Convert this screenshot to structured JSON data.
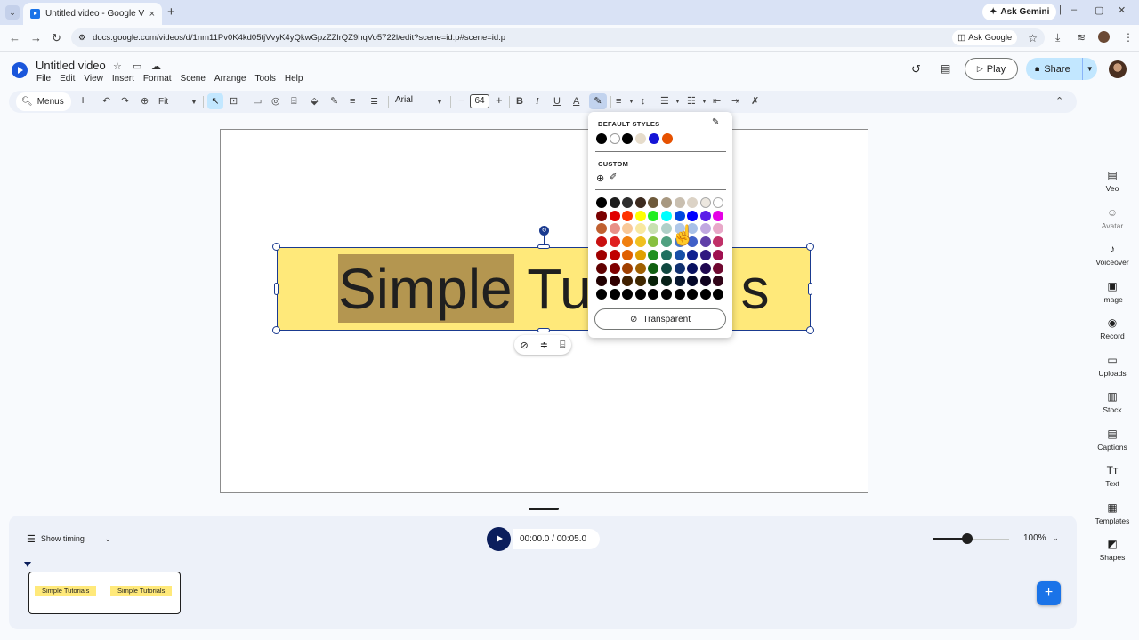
{
  "browser": {
    "tab_title": "Untitled video - Google Vids",
    "tab_close": "×",
    "new_tab": "+",
    "url": "docs.google.com/videos/d/1nm11Pv0K4kd05tjVvyK4yQkwGpzZZlrQZ9hqVo5722l/edit?scene=id.p#scene=id.p",
    "ask_google": "Ask Google",
    "ask_gemini": "Ask Gemini"
  },
  "app": {
    "title": "Untitled video",
    "menus": [
      "File",
      "Edit",
      "View",
      "Insert",
      "Format",
      "Scene",
      "Arrange",
      "Tools",
      "Help"
    ],
    "play_label": "Play",
    "share_label": "Share"
  },
  "toolbar": {
    "menus_label": "Menus",
    "zoom": "Fit",
    "font": "Arial",
    "font_size": "64"
  },
  "canvas": {
    "text": "Simple Tutorials",
    "text_left": "Simple Tu",
    "text_right": "s"
  },
  "palette": {
    "default_label": "DEFAULT STYLES",
    "custom_label": "CUSTOM",
    "transparent_label": "Transparent",
    "default_colors": [
      "#000000",
      "#ffffff",
      "#000000",
      "#e6dccb",
      "#1414d6",
      "#e65100"
    ],
    "grid": [
      [
        "#000000",
        "#1c1c1c",
        "#2e2e2e",
        "#3d2b1f",
        "#6e5a3b",
        "#a89880",
        "#c9bfb0",
        "#dcd3c6",
        "#ece7df",
        "#ffffff"
      ],
      [
        "#7a0000",
        "#e00000",
        "#ff3300",
        "#ffff00",
        "#22ee22",
        "#00ffff",
        "#0047e0",
        "#0000ff",
        "#5a1ee8",
        "#e600e6"
      ],
      [
        "#c06030",
        "#e89088",
        "#f8c898",
        "#f8e8a0",
        "#c8e0b0",
        "#b0d0c8",
        "#b0c8e8",
        "#a8c0e8",
        "#c0a8e0",
        "#e8a8c8"
      ],
      [
        "#c81010",
        "#e02020",
        "#f08010",
        "#f0c020",
        "#88c040",
        "#50a080",
        "#4878c8",
        "#4060c8",
        "#6040a8",
        "#c03068"
      ],
      [
        "#a00000",
        "#c00000",
        "#e06000",
        "#e0a000",
        "#209020",
        "#207060",
        "#1850a8",
        "#102090",
        "#301880",
        "#a01050"
      ],
      [
        "#600000",
        "#800000",
        "#a04000",
        "#a06000",
        "#106010",
        "#104840",
        "#103070",
        "#081060",
        "#200850",
        "#700830"
      ],
      [
        "#200000",
        "#300000",
        "#402000",
        "#402800",
        "#082008",
        "#082018",
        "#081830",
        "#040828",
        "#100420",
        "#300418"
      ],
      [
        "#000000",
        "#000000",
        "#000000",
        "#000000",
        "#000000",
        "#000000",
        "#000000",
        "#000000",
        "#000000",
        "#000000"
      ]
    ]
  },
  "rail": [
    {
      "label": "Veo",
      "icon": "veo-icon",
      "glyph": "▤"
    },
    {
      "label": "Avatar",
      "icon": "avatar-icon",
      "glyph": "☺"
    },
    {
      "label": "Voiceover",
      "icon": "voiceover-icon",
      "glyph": "♪"
    },
    {
      "label": "Image",
      "icon": "image-icon",
      "glyph": "▣"
    },
    {
      "label": "Record",
      "icon": "record-icon",
      "glyph": "◉"
    },
    {
      "label": "Uploads",
      "icon": "uploads-icon",
      "glyph": "▭"
    },
    {
      "label": "Stock",
      "icon": "stock-icon",
      "glyph": "▥"
    },
    {
      "label": "Captions",
      "icon": "captions-icon",
      "glyph": "▤"
    },
    {
      "label": "Text",
      "icon": "text-icon",
      "glyph": "Tт"
    },
    {
      "label": "Templates",
      "icon": "templates-icon",
      "glyph": "▦"
    },
    {
      "label": "Shapes",
      "icon": "shapes-icon",
      "glyph": "◩"
    }
  ],
  "timeline": {
    "show_timing": "Show timing",
    "time": "00:00.0 / 00:05.0",
    "zoom": "100%",
    "zoom_level": 0.45,
    "clip_texts": [
      "Simple Tutorials",
      "Simple Tutorials"
    ]
  }
}
